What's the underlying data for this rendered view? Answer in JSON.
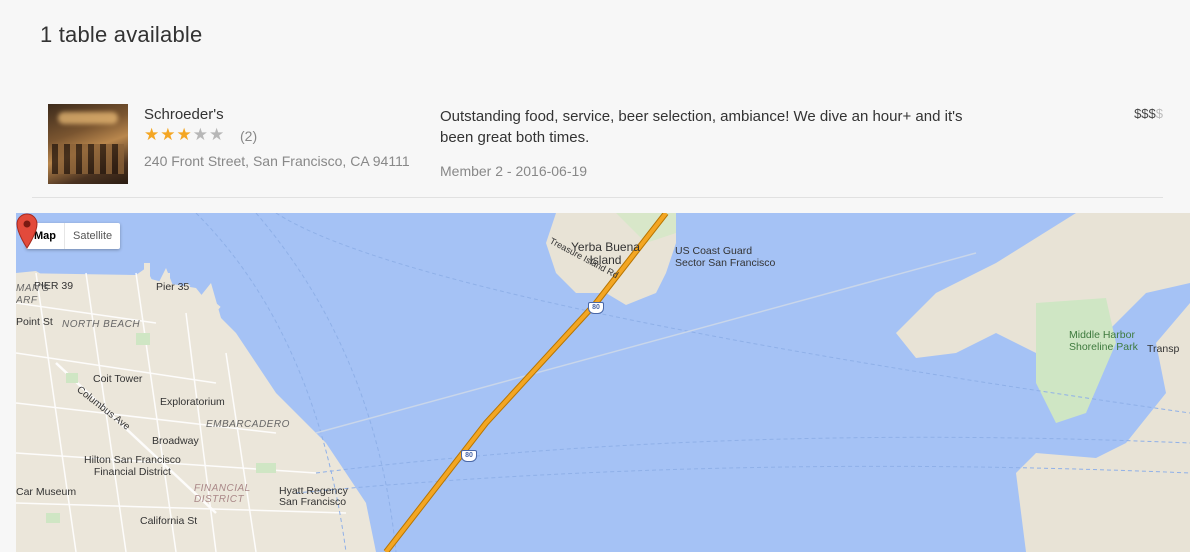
{
  "page": {
    "heading": "1 table available"
  },
  "restaurant": {
    "name": "Schroeder's",
    "rating": 3,
    "rating_max": 5,
    "reviews_count": "(2)",
    "address": "240 Front Street, San Francisco, CA 94111",
    "review_text": "Outstanding food, service, beer selection, ambiance! We dive an hour+ and it's been great both times.",
    "review_meta": "Member 2 - 2016-06-19",
    "price_active": "$$$",
    "price_inactive": "$"
  },
  "map": {
    "type_map": "Map",
    "type_satellite": "Satellite",
    "labels": {
      "yerba_buena": "Yerba Buena\nIsland",
      "coast_guard": "US Coast Guard\nSector San Francisco",
      "treasure_rd": "Treasure Island Rd",
      "pier39": "PIER 39",
      "pier35": "Pier 35",
      "wharf": "MAN'S\nARF",
      "north_beach": "NORTH BEACH",
      "point_st": "Point St",
      "coit": "Coit Tower",
      "columbus": "Columbus Ave",
      "exploratorium": "Exploratorium",
      "embarcadero": "EMBARCADERO",
      "broadway": "Broadway",
      "hilton": "Hilton San Francisco\nFinancial District",
      "car_museum": "Car Museum",
      "financial": "FINANCIAL\nDISTRICT",
      "hyatt": "Hyatt Regency\nSan Francisco",
      "california": "California St",
      "middle_harbor": "Middle Harbor\nShoreline Park",
      "transp": "Transp",
      "i80": "80"
    }
  }
}
